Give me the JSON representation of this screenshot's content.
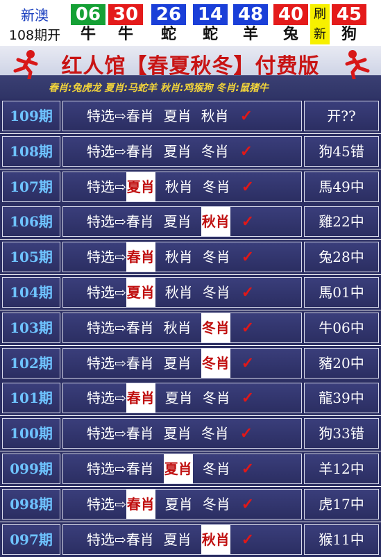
{
  "header": {
    "site": "新澳",
    "issue": "108期开",
    "balls": [
      {
        "num": "06",
        "zodiac": "牛",
        "color": "#15a035"
      },
      {
        "num": "30",
        "zodiac": "牛",
        "color": "#e41b1b"
      },
      {
        "num": "26",
        "zodiac": "蛇",
        "color": "#1a3fd8"
      },
      {
        "num": "14",
        "zodiac": "蛇",
        "color": "#1a3fd8"
      },
      {
        "num": "48",
        "zodiac": "羊",
        "color": "#1a3fd8"
      },
      {
        "num": "40",
        "zodiac": "兔",
        "color": "#e41b1b"
      }
    ],
    "refresh": [
      "刷",
      "新"
    ],
    "special": {
      "num": "45",
      "zodiac": "狗",
      "color": "#e41b1b"
    }
  },
  "banner": {
    "title_left": "红人馆",
    "title_mid": "【春夏秋冬】",
    "title_right": "付费版",
    "subtitle": "春肖:兔虎龙 夏肖:马蛇羊 秋肖:鸡猴狗 冬肖:鼠猪牛"
  },
  "arrow": "⇨",
  "check": "✓",
  "rows": [
    {
      "issue": "109期",
      "prefix": "特选",
      "picks": [
        {
          "t": "春肖",
          "hit": false
        },
        {
          "t": "夏肖",
          "hit": false
        },
        {
          "t": "秋肖",
          "hit": false
        }
      ],
      "result": "开??"
    },
    {
      "issue": "108期",
      "prefix": "特选",
      "picks": [
        {
          "t": "春肖",
          "hit": false
        },
        {
          "t": "夏肖",
          "hit": false
        },
        {
          "t": "冬肖",
          "hit": false
        }
      ],
      "result": "狗45错"
    },
    {
      "issue": "107期",
      "prefix": "特选",
      "picks": [
        {
          "t": "夏肖",
          "hit": true
        },
        {
          "t": "秋肖",
          "hit": false
        },
        {
          "t": "冬肖",
          "hit": false
        }
      ],
      "result": "馬49中"
    },
    {
      "issue": "106期",
      "prefix": "特选",
      "picks": [
        {
          "t": "春肖",
          "hit": false
        },
        {
          "t": "夏肖",
          "hit": false
        },
        {
          "t": "秋肖",
          "hit": true
        }
      ],
      "result": "雞22中"
    },
    {
      "issue": "105期",
      "prefix": "特选",
      "picks": [
        {
          "t": "春肖",
          "hit": true
        },
        {
          "t": "秋肖",
          "hit": false
        },
        {
          "t": "冬肖",
          "hit": false
        }
      ],
      "result": "兔28中"
    },
    {
      "issue": "104期",
      "prefix": "特选",
      "picks": [
        {
          "t": "夏肖",
          "hit": true
        },
        {
          "t": "秋肖",
          "hit": false
        },
        {
          "t": "冬肖",
          "hit": false
        }
      ],
      "result": "馬01中"
    },
    {
      "issue": "103期",
      "prefix": "特选",
      "picks": [
        {
          "t": "春肖",
          "hit": false
        },
        {
          "t": "秋肖",
          "hit": false
        },
        {
          "t": "冬肖",
          "hit": true
        }
      ],
      "result": "牛06中"
    },
    {
      "issue": "102期",
      "prefix": "特选",
      "picks": [
        {
          "t": "春肖",
          "hit": false
        },
        {
          "t": "夏肖",
          "hit": false
        },
        {
          "t": "冬肖",
          "hit": true
        }
      ],
      "result": "豬20中"
    },
    {
      "issue": "101期",
      "prefix": "特选",
      "picks": [
        {
          "t": "春肖",
          "hit": true
        },
        {
          "t": "夏肖",
          "hit": false
        },
        {
          "t": "冬肖",
          "hit": false
        }
      ],
      "result": "龍39中"
    },
    {
      "issue": "100期",
      "prefix": "特选",
      "picks": [
        {
          "t": "春肖",
          "hit": false
        },
        {
          "t": "夏肖",
          "hit": false
        },
        {
          "t": "冬肖",
          "hit": false
        }
      ],
      "result": "狗33错"
    },
    {
      "issue": "099期",
      "prefix": "特选",
      "picks": [
        {
          "t": "春肖",
          "hit": false
        },
        {
          "t": "夏肖",
          "hit": true
        },
        {
          "t": "冬肖",
          "hit": false
        }
      ],
      "result": "羊12中"
    },
    {
      "issue": "098期",
      "prefix": "特选",
      "picks": [
        {
          "t": "春肖",
          "hit": true
        },
        {
          "t": "夏肖",
          "hit": false
        },
        {
          "t": "冬肖",
          "hit": false
        }
      ],
      "result": "虎17中"
    },
    {
      "issue": "097期",
      "prefix": "特选",
      "picks": [
        {
          "t": "春肖",
          "hit": false
        },
        {
          "t": "夏肖",
          "hit": false
        },
        {
          "t": "秋肖",
          "hit": true
        }
      ],
      "result": "猴11中"
    }
  ]
}
